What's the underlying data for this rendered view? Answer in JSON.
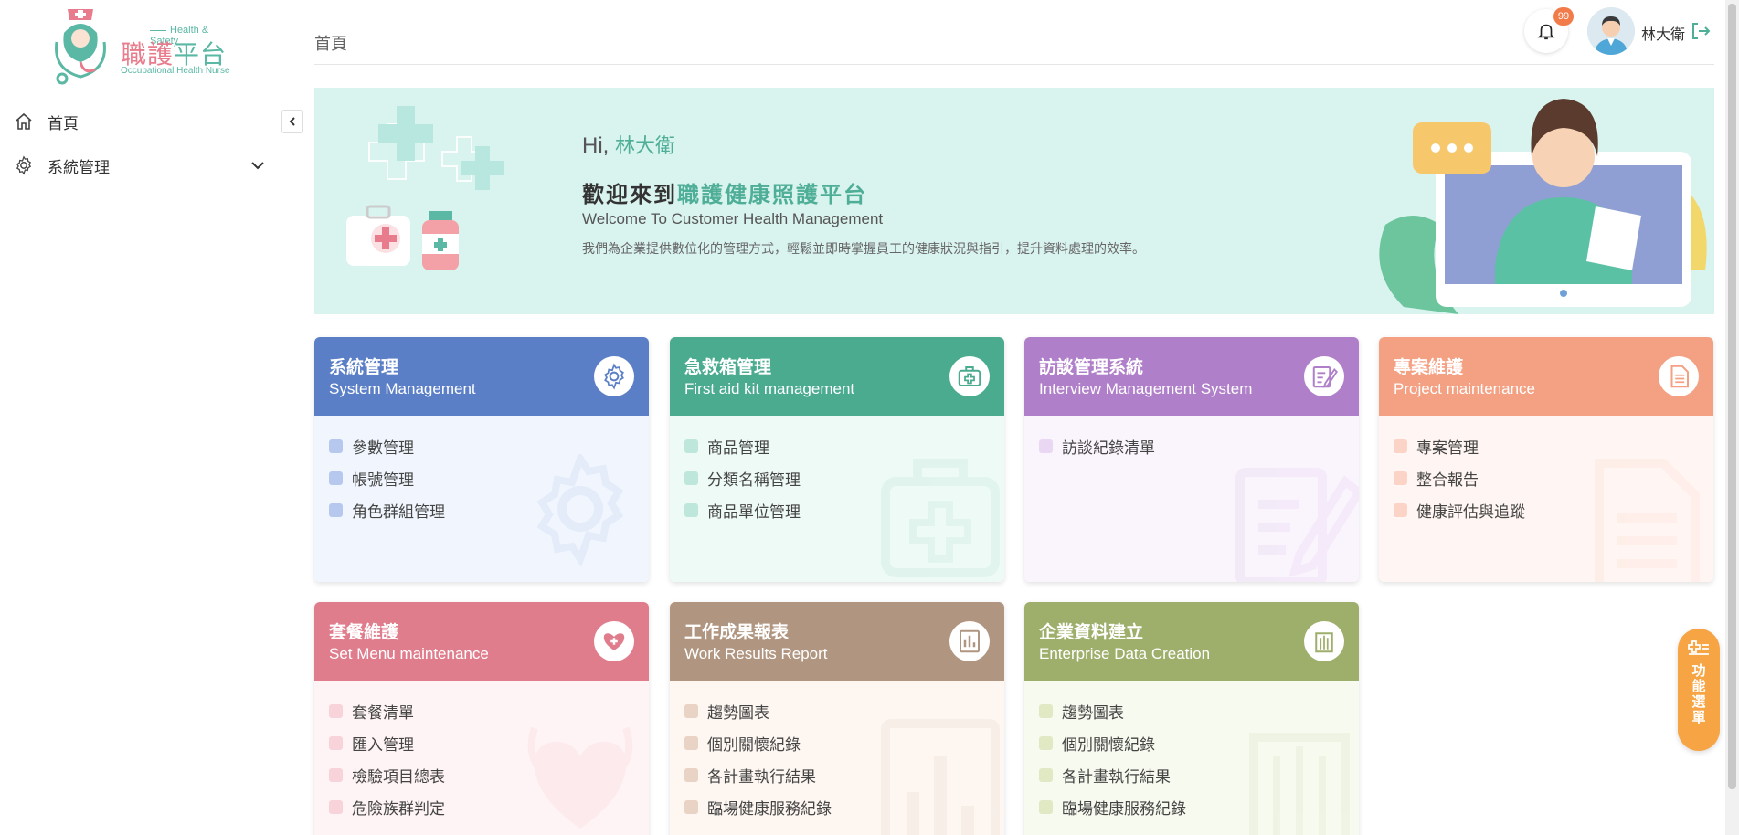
{
  "logo": {
    "small": "Health & Safety",
    "main_a": "職護",
    "main_b": "平台",
    "sub": "Occupational Health Nurse"
  },
  "sidebar": {
    "items": [
      {
        "label": "首頁",
        "icon": "home-icon"
      },
      {
        "label": "系統管理",
        "icon": "gear-icon"
      }
    ]
  },
  "header": {
    "breadcrumb": "首頁",
    "notification_count": "99",
    "username": "林大衛"
  },
  "banner": {
    "hi": "Hi, ",
    "name": "林大衛",
    "welcome_prefix": "歡迎來到",
    "welcome_highlight": "職護健康照護平台",
    "welcome_en": "Welcome To Customer Health Management",
    "description": "我們為企業提供數位化的管理方式，輕鬆並即時掌握員工的健康狀況與指引，提升資料處理的效率。"
  },
  "cards": [
    {
      "title": "系統管理",
      "subtitle": "System Management",
      "color": "#5b7fc7",
      "body_color": "#f1f6fe",
      "dot_color": "#b7c8ee",
      "icon": "gear-icon",
      "items": [
        "參數管理",
        "帳號管理",
        "角色群組管理"
      ]
    },
    {
      "title": "急救箱管理",
      "subtitle": "First aid kit management",
      "color": "#4aab8f",
      "body_color": "#eefaf6",
      "dot_color": "#bfe6da",
      "icon": "first-aid-kit-icon",
      "items": [
        "商品管理",
        "分類名稱管理",
        "商品單位管理"
      ]
    },
    {
      "title": "訪談管理系統",
      "subtitle": "Interview Management System",
      "color": "#b07fc9",
      "body_color": "#faf4fd",
      "dot_color": "#e9d7f3",
      "icon": "edit-note-icon",
      "items": [
        "訪談紀錄清單"
      ]
    },
    {
      "title": "專案維護",
      "subtitle": "Project maintenance",
      "color": "#f4a083",
      "body_color": "#fff5f2",
      "dot_color": "#fbd3c7",
      "icon": "document-icon",
      "items": [
        "專案管理",
        "整合報告",
        "健康評估與追蹤"
      ]
    },
    {
      "title": "套餐維護",
      "subtitle": "Set Menu maintenance",
      "color": "#e07d8d",
      "body_color": "#fff4f5",
      "dot_color": "#f8d3d9",
      "icon": "stethoscope-heart-icon",
      "items": [
        "套餐清單",
        "匯入管理",
        "檢驗項目總表",
        "危險族群判定"
      ]
    },
    {
      "title": "工作成果報表",
      "subtitle": "Work Results Report",
      "color": "#b09580",
      "body_color": "#fdf6f1",
      "dot_color": "#e8d3c4",
      "icon": "bar-chart-icon",
      "items": [
        "趨勢圖表",
        "個別關懷紀錄",
        "各計畫執行結果",
        "臨場健康服務紀錄"
      ]
    },
    {
      "title": "企業資料建立",
      "subtitle": "Enterprise Data Creation",
      "color": "#9eae6b",
      "body_color": "#f7faef",
      "dot_color": "#e0e8c4",
      "icon": "building-icon",
      "items": [
        "趨勢圖表",
        "個別關懷紀錄",
        "各計畫執行結果",
        "臨場健康服務紀錄"
      ]
    }
  ],
  "float_menu": {
    "label": "功能選單"
  }
}
